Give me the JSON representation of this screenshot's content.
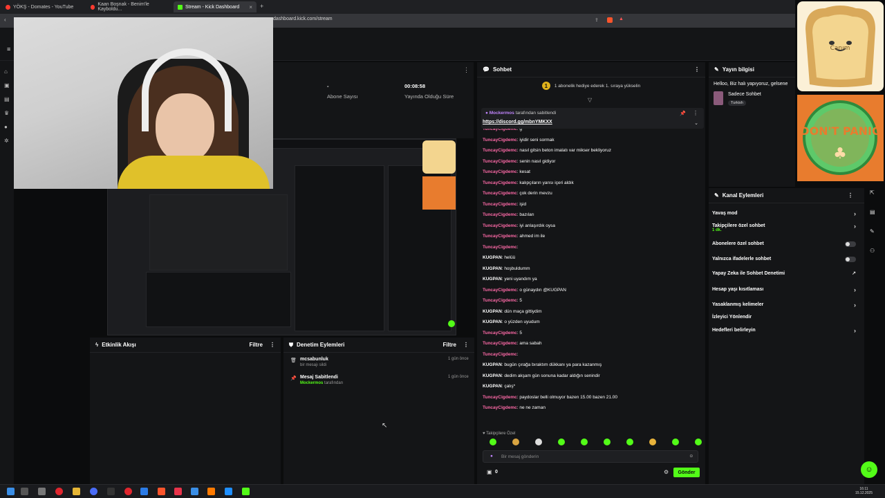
{
  "browser": {
    "tabs": [
      {
        "label": "YÖKŞ - Domates - YouTube",
        "icon": "youtube-icon",
        "color": "#ff3b30"
      },
      {
        "label": "Kaan Boşnak - Benim'le Kayboldu...",
        "icon": "audio-icon",
        "color": "#ff3b30"
      },
      {
        "label": "Stream - Kick Dashboard",
        "icon": "kick-icon",
        "color": "#53fc18"
      }
    ],
    "new_tab": "+",
    "url": "dashboard.kick.com/stream"
  },
  "stats": {
    "followers_value": "-",
    "followers_label": "Abone Sayısı",
    "uptime_value": "00:08:58",
    "uptime_label": "Yayında Olduğu Süre"
  },
  "chat": {
    "title": "Sohbet",
    "gift_notice": "1 abonelik hediye ederek 1. sıraya yükselin",
    "gift_rank": "1",
    "pinned_by_user": "Mockermos",
    "pinned_by_text": "tarafından sabitlendi",
    "pinned_link": "https://discord.gg/mbnYMKXX",
    "messages": [
      {
        "user": "TuncayCigdemc",
        "text": "g",
        "color": "#ff6aa8"
      },
      {
        "user": "TuncayCigdemc",
        "text": "iyidir seni sormak",
        "color": "#ff6aa8"
      },
      {
        "user": "TuncayCigdemc",
        "text": "nasıl gitsin beton imalatı var mikser bekliyoruz",
        "color": "#ff6aa8"
      },
      {
        "user": "TuncayCigdemc",
        "text": "senin nasıl gidiyor",
        "color": "#ff6aa8"
      },
      {
        "user": "TuncayCigdemc",
        "text": "kesat",
        "color": "#ff6aa8"
      },
      {
        "user": "TuncayCigdemc",
        "text": "kalıpçıların yarısı içeri aldık",
        "color": "#ff6aa8"
      },
      {
        "user": "TuncayCigdemc",
        "text": "çok derin mevzu",
        "color": "#ff6aa8"
      },
      {
        "user": "TuncayCigdemc",
        "text": "işid",
        "color": "#ff6aa8"
      },
      {
        "user": "TuncayCigdemc",
        "text": "bazıları",
        "color": "#ff6aa8"
      },
      {
        "user": "TuncayCigdemc",
        "text": "iyi anlaşırdık oysa",
        "color": "#ff6aa8"
      },
      {
        "user": "TuncayCigdemc",
        "text": "ahmed im ile",
        "color": "#ff6aa8"
      },
      {
        "user": "TuncayCigdemc",
        "text": "",
        "color": "#ff6aa8"
      },
      {
        "user": "KUGPAN",
        "text": "helüü",
        "color": "#ffffff"
      },
      {
        "user": "KUGPAN",
        "text": "hoşbuldumm",
        "color": "#ffffff"
      },
      {
        "user": "KUGPAN",
        "text": "yeni uyandım ya",
        "color": "#ffffff"
      },
      {
        "user": "TuncayCigdemc",
        "text": "o günaydın @KUGPAN",
        "color": "#ff6aa8"
      },
      {
        "user": "TuncayCigdemc",
        "text": "5",
        "color": "#ff6aa8"
      },
      {
        "user": "KUGPAN",
        "text": "dün maça gittiydim",
        "color": "#ffffff"
      },
      {
        "user": "KUGPAN",
        "text": "o yüzden uyudum",
        "color": "#ffffff"
      },
      {
        "user": "TuncayCigdemc",
        "text": "5",
        "color": "#ff6aa8"
      },
      {
        "user": "TuncayCigdemc",
        "text": "ama sabah",
        "color": "#ff6aa8"
      },
      {
        "user": "TuncayCigdemc",
        "text": "",
        "color": "#ff6aa8"
      },
      {
        "user": "KUGPAN",
        "text": "bugün çırağa bıraktım dükkanı ya para kazanmış",
        "color": "#ffffff"
      },
      {
        "user": "KUGPAN",
        "text": "dedim akşam gün sonuna kadar aldığın senindir",
        "color": "#ffffff"
      },
      {
        "user": "KUGPAN",
        "text": "çalış*",
        "color": "#ffffff"
      },
      {
        "user": "TuncayCigdemc",
        "text": "paydoslar belli olmuyor bazen 15.00 bazen 21.00",
        "color": "#ff6aa8"
      },
      {
        "user": "TuncayCigdemc",
        "text": "ne ne zaman",
        "color": "#ff6aa8"
      }
    ],
    "followers_only": "Takipçilere Özel",
    "input_placeholder": "Bir mesaj gönderin",
    "counter": "0",
    "send_label": "Gönder"
  },
  "activity": {
    "title": "Etkinlik Akışı",
    "filter": "Filtre"
  },
  "moderation": {
    "title": "Denetim Eylemleri",
    "filter": "Filtre",
    "items": [
      {
        "title": "mcsabunluk",
        "sub_user": "",
        "sub": "bir mesajı sildi",
        "ago": "1 gün önce",
        "icon": "trash-icon"
      },
      {
        "title": "Mesaj Sabitlendi",
        "sub_user": "Mockermos",
        "sub": "tarafından",
        "ago": "1 gün önce",
        "icon": "pin-icon"
      }
    ]
  },
  "stream_info": {
    "title": "Yayın bilgisi",
    "description": "Helloo, Biz halı yapıyoruz, gelsene",
    "category": "Sadece Sohbet",
    "language": "Turkish"
  },
  "channel_actions": {
    "title": "Kanal Eylemleri",
    "items": [
      {
        "label": "Yavaş mod",
        "sub": "",
        "control": "chevron"
      },
      {
        "label": "Takipçilere özel sohbet",
        "sub": "1 dk.",
        "control": "chevron"
      },
      {
        "label": "Abonelere özel sohbet",
        "sub": "",
        "control": "toggle"
      },
      {
        "label": "Yalnızca ifadelerle sohbet",
        "sub": "",
        "control": "toggle"
      },
      {
        "label": "Yapay Zeka ile Sohbet Denetimi",
        "sub": "",
        "control": "external"
      },
      {
        "label": "Hesap yaşı kısıtlaması",
        "sub": "",
        "control": "chevron"
      },
      {
        "label": "Yasaklanmış kelimeler",
        "sub": "",
        "control": "chevron"
      },
      {
        "label": "İzleyici Yönlendir",
        "sub": "",
        "control": "none"
      },
      {
        "label": "Hedefleri belirleyin",
        "sub": "",
        "control": "chevron"
      }
    ]
  },
  "overlays": {
    "toast_text": "Canım",
    "panic_text": "DON'T PANIC"
  },
  "taskbar": {
    "time": "16:11",
    "date": "15.12.2025"
  },
  "colors": {
    "accent": "#53fc18",
    "chat_user": "#ff6aa8",
    "pinned_user": "#c084fc"
  }
}
